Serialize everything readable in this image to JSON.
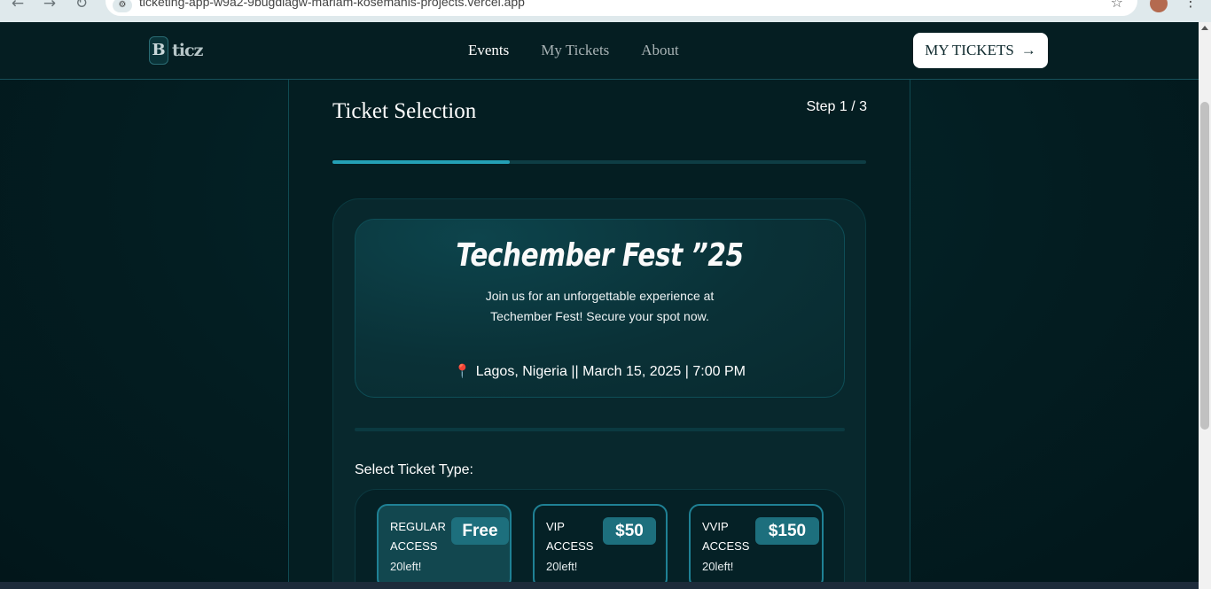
{
  "browser": {
    "url": "ticketing-app-w9a2-9bugdiagw-mariam-kosemanis-projects.vercel.app"
  },
  "header": {
    "logo_letter": "B",
    "logo_text": "ticz",
    "nav": [
      {
        "label": "Events",
        "active": true
      },
      {
        "label": "My Tickets",
        "active": false
      },
      {
        "label": "About",
        "active": false
      }
    ],
    "cta_label": "MY TICKETS",
    "cta_arrow": "→"
  },
  "step": {
    "title": "Ticket Selection",
    "counter": "Step 1 / 3",
    "progress_fraction": 0.333
  },
  "event": {
    "title": "Techember Fest ”25",
    "description": "Join us for an unforgettable experience at Techember Fest! Secure your spot now.",
    "location": "Lagos, Nigeria",
    "separator": "||",
    "datetime": "March 15, 2025 | 7:00 PM",
    "pin_icon": "📍"
  },
  "tickets": {
    "label": "Select Ticket Type:",
    "options": [
      {
        "name_line1": "REGULAR",
        "name_line2": "ACCESS",
        "price": "Free",
        "left": "20left!",
        "selected": true
      },
      {
        "name_line1": "VIP",
        "name_line2": "ACCESS",
        "price": "$50",
        "left": "20left!",
        "selected": false
      },
      {
        "name_line1": "VVIP",
        "name_line2": "ACCESS",
        "price": "$150",
        "left": "20left!",
        "selected": false
      }
    ]
  },
  "colors": {
    "accent": "#24a0b5",
    "background": "#02191d",
    "price_badge": "#1d6f7d"
  }
}
